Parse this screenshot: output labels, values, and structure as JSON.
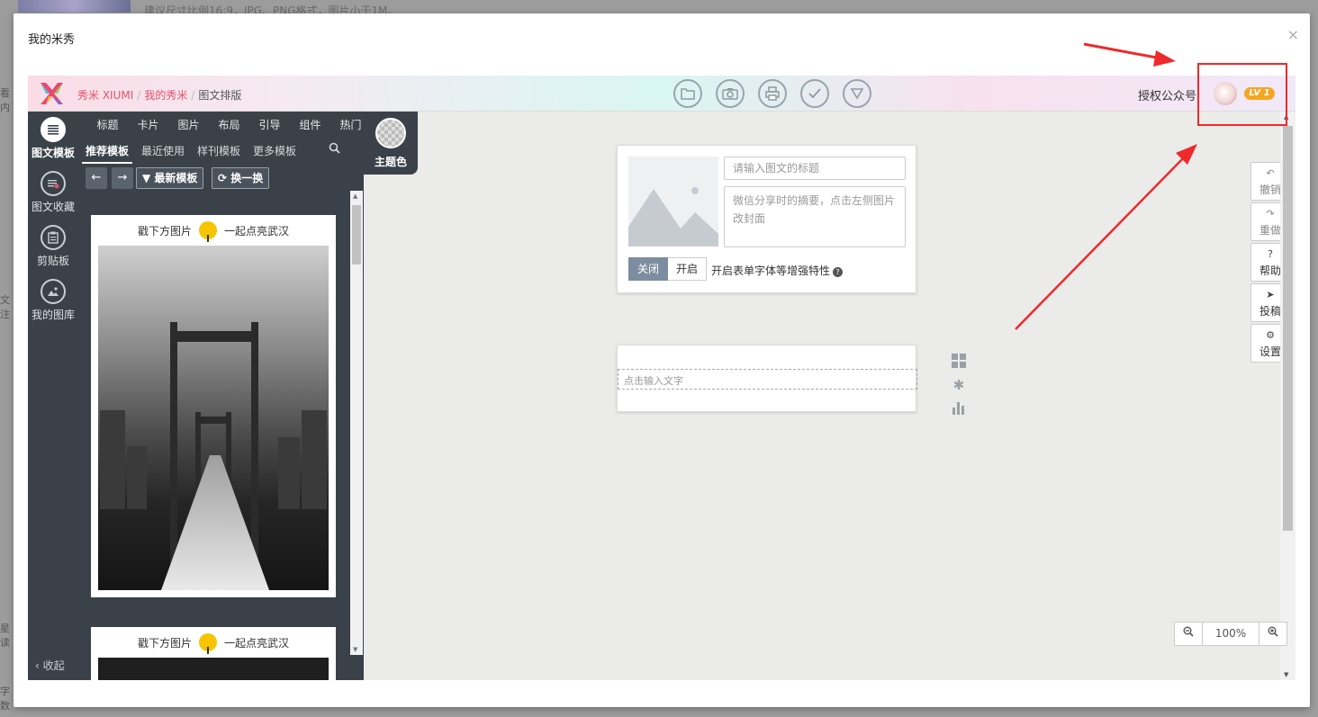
{
  "background": {
    "hint": "建议尺寸比例16:9，JPG、PNG格式，图片小于1M。",
    "side_fragments": [
      "看内",
      "文注",
      "星读",
      "字数"
    ]
  },
  "modal": {
    "title": "我的米秀",
    "close_label": "×"
  },
  "topbar": {
    "breadcrumbs": [
      "秀米 XIUMI",
      "我的秀米",
      "图文排版"
    ],
    "breadcrumb_sep": "/",
    "auth_label": "授权公众号",
    "level_badge": "LV 1",
    "tool_icons": [
      "folder-icon",
      "camera-icon",
      "print-icon",
      "check-icon",
      "triangle-down-icon"
    ]
  },
  "leftnav": {
    "items": [
      {
        "label": "图文模板",
        "icon": "list-icon",
        "active": true
      },
      {
        "label": "图文收藏",
        "icon": "favorite-list-icon",
        "active": false
      },
      {
        "label": "剪贴板",
        "icon": "clipboard-icon",
        "active": false
      },
      {
        "label": "我的图库",
        "icon": "image-library-icon",
        "active": false
      }
    ],
    "collapse_label": "收起",
    "collapse_icon": "‹"
  },
  "template_panel": {
    "category_tabs": [
      "标题",
      "卡片",
      "图片",
      "布局",
      "引导",
      "组件",
      "热门"
    ],
    "sub_tabs": [
      {
        "label": "推荐模板",
        "active": true
      },
      {
        "label": "最近使用",
        "active": false
      },
      {
        "label": "样刊模板",
        "active": false
      },
      {
        "label": "更多模板",
        "active": false
      }
    ],
    "theme_label": "主题色",
    "prev_icon": "←",
    "next_icon": "→",
    "newest_label": "最新模板",
    "shuffle_label": "换一换",
    "cards": [
      {
        "caption_left": "戳下方图片",
        "caption_right": "一起点亮武汉"
      },
      {
        "caption_left": "戳下方图片",
        "caption_right": "一起点亮武汉"
      }
    ]
  },
  "editor": {
    "title_placeholder": "请输入图文的标题",
    "summary_placeholder": "微信分享时的摘要，点击左侧图片改封面",
    "toggle_off": "关闭",
    "toggle_on": "开启",
    "toggle_label": "开启表单字体等增强特性",
    "text_placeholder": "点击输入文字"
  },
  "right_tools": [
    {
      "label": "撤销",
      "icon": "↶",
      "dim": true
    },
    {
      "label": "重做",
      "icon": "↷",
      "dim": true
    },
    {
      "label": "帮助",
      "icon": "?",
      "dim": false
    },
    {
      "label": "投稿",
      "icon": "➤",
      "dim": false
    },
    {
      "label": "设置",
      "icon": "⚙",
      "dim": false
    }
  ],
  "zoom": {
    "value": "100%",
    "zoom_out_icon": "−",
    "zoom_in_icon": "+"
  },
  "annotation_color": "#ee2a2a"
}
